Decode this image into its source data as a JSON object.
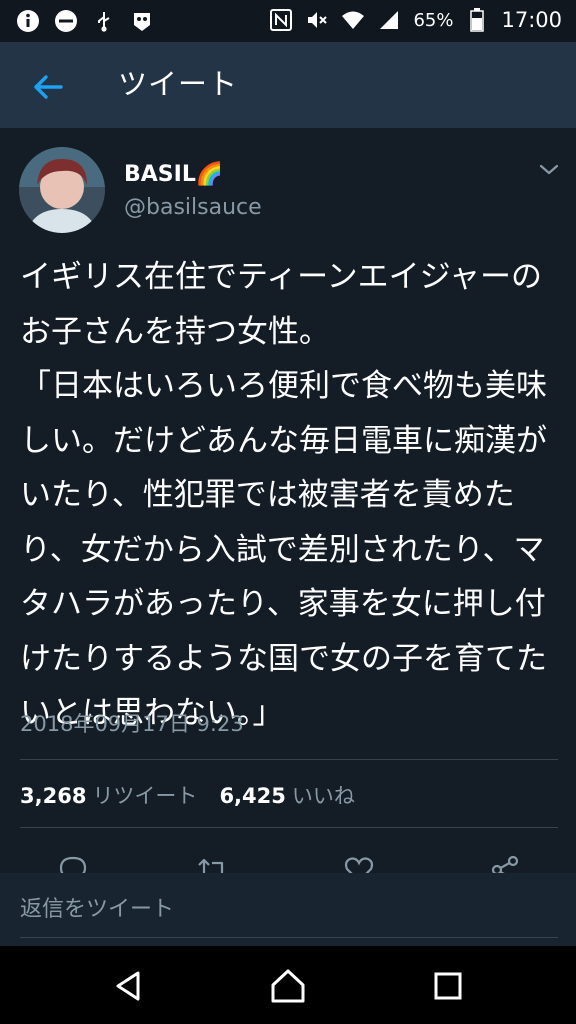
{
  "status_bar": {
    "battery_percent": "65%",
    "time": "17:00",
    "left_icons": [
      "info-icon",
      "do-not-disturb-icon",
      "usb-debug-icon",
      "app-notification-icon"
    ],
    "right_icons": [
      "nfc-icon",
      "mute-icon",
      "wifi-icon",
      "signal-icon",
      "battery-icon"
    ]
  },
  "header": {
    "title": "ツイート",
    "back_icon": "back-arrow-icon"
  },
  "tweet": {
    "display_name": "BASIL🌈",
    "handle": "@basilsauce",
    "text": "イギリス在住でティーンエイジャーのお子さんを持つ女性。\n「日本はいろいろ便利で食べ物も美味しい。だけどあんな毎日電車に痴漢がいたり、性犯罪では被害者を責めたり、女だから入試で差別されたり、マタハラがあったり、家事を女に押し付けたりするような国で女の子を育てたいとは思わない。」",
    "timestamp": "2018年09月17日 9:23",
    "retweet_count": "3,268",
    "retweet_label": "リツイート",
    "like_count": "6,425",
    "like_label": "いいね"
  },
  "actions": [
    "reply-icon",
    "retweet-icon",
    "like-icon",
    "share-icon"
  ],
  "reply": {
    "placeholder": "返信をツイート"
  },
  "colors": {
    "background": "#141d26",
    "header": "#243447",
    "accent": "#1da1f2",
    "secondary_text": "#8899a6",
    "divider": "#38444d"
  }
}
